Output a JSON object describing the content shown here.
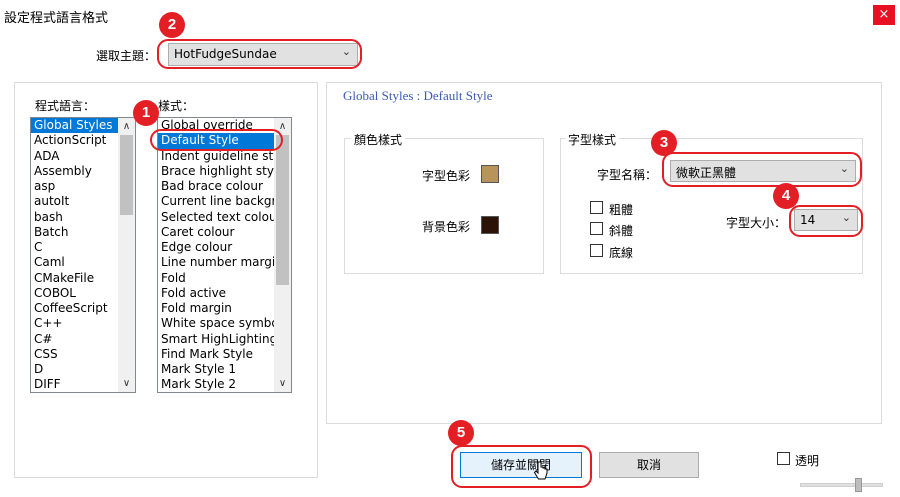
{
  "window": {
    "title": "設定程式語言格式",
    "close_glyph": "×"
  },
  "theme": {
    "label": "選取主題：",
    "selected": "HotFudgeSundae"
  },
  "languages": {
    "label": "程式語言：",
    "items": [
      "Global Styles",
      "ActionScript",
      "ADA",
      "Assembly",
      "asp",
      "autoIt",
      "bash",
      "Batch",
      "C",
      "Caml",
      "CMakeFile",
      "COBOL",
      "CoffeeScript",
      "C++",
      "C#",
      "CSS",
      "D",
      "DIFF"
    ],
    "selected": "Global Styles"
  },
  "styles": {
    "label": "樣式：",
    "items": [
      "Global override",
      "Default Style",
      "Indent guideline style",
      "Brace highlight style",
      "Bad brace colour",
      "Current line background",
      "Selected text colour",
      "Caret colour",
      "Edge colour",
      "Line number margin",
      "Fold",
      "Fold active",
      "Fold margin",
      "White space symbol",
      "Smart HighLighting",
      "Find Mark Style",
      "Mark Style 1",
      "Mark Style 2"
    ],
    "selected": "Default Style"
  },
  "panel": {
    "heading": "Global Styles : Default Style"
  },
  "color_style": {
    "title": "顏色樣式",
    "fg_label": "字型色彩",
    "bg_label": "背景色彩",
    "fg_color": "#b8935a",
    "bg_color": "#2b1308"
  },
  "font_style": {
    "title": "字型樣式",
    "name_label": "字型名稱：",
    "name_value": "微軟正黑體",
    "size_label": "字型大小：",
    "size_value": "14",
    "bold_label": "粗體",
    "italic_label": "斜體",
    "underline_label": "底線"
  },
  "buttons": {
    "save_close": "儲存並關閉",
    "cancel": "取消"
  },
  "transparency": {
    "label": "透明"
  },
  "annotations": {
    "badges": [
      "1",
      "2",
      "3",
      "4",
      "5"
    ],
    "highlight_color": "#e31e24"
  },
  "icons": {
    "combo_arrow": "⌄",
    "scroll_up": "∧",
    "scroll_down": "∨"
  }
}
